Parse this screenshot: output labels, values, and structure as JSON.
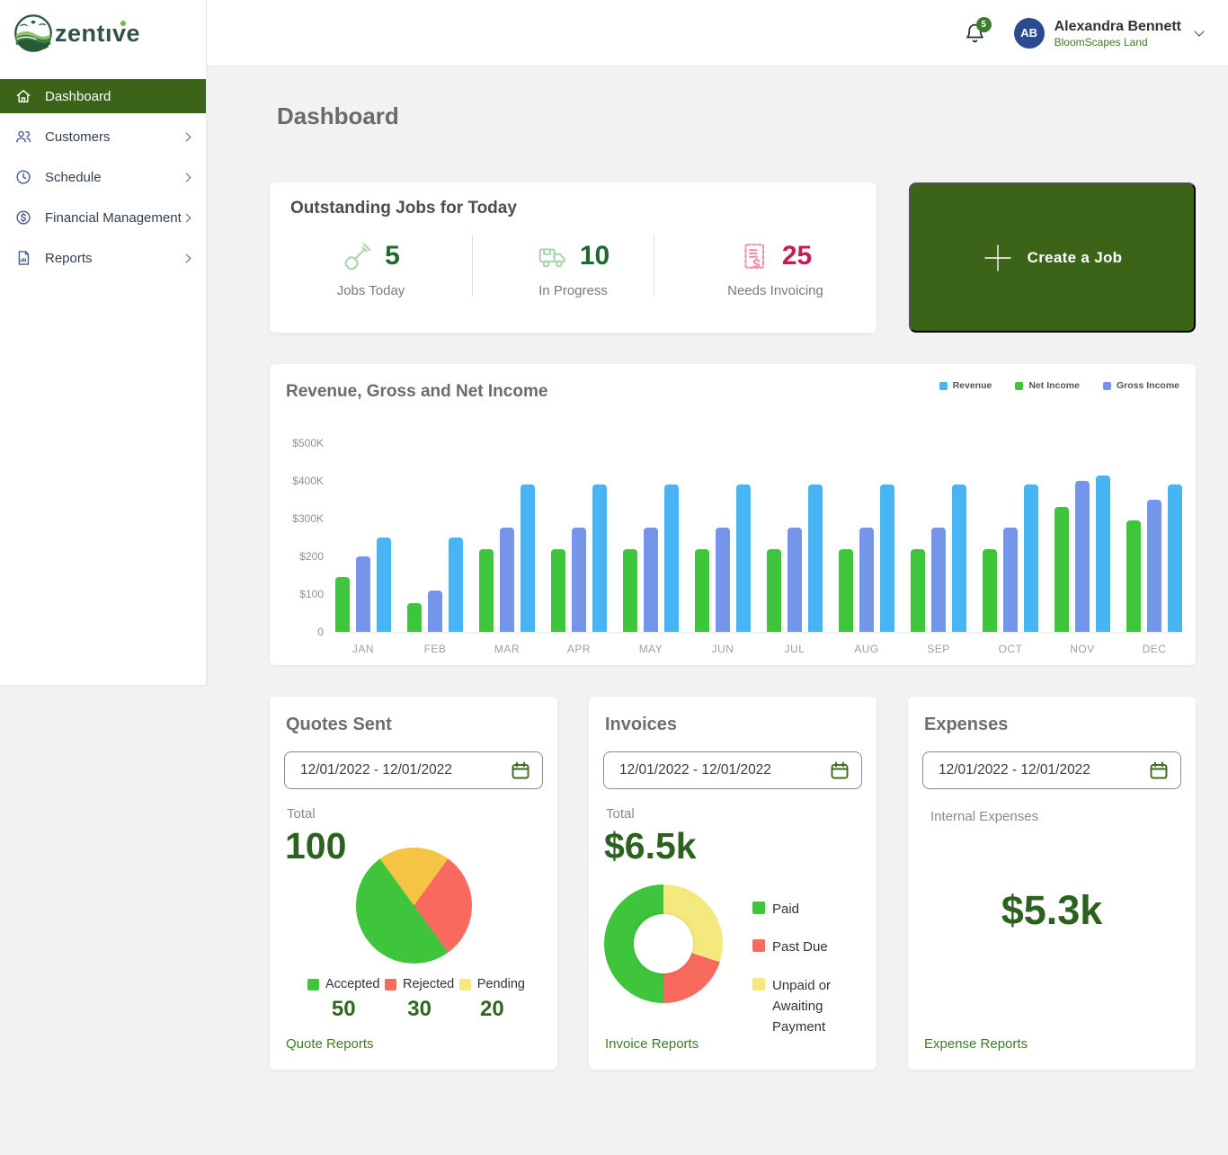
{
  "brand": {
    "name": "zentive"
  },
  "sidebar": {
    "items": [
      {
        "label": "Dashboard",
        "icon": "home-icon",
        "active": true
      },
      {
        "label": "Customers",
        "icon": "users-icon",
        "active": false
      },
      {
        "label": "Schedule",
        "icon": "clock-icon",
        "active": false
      },
      {
        "label": "Financial Management",
        "icon": "dollar-circle-icon",
        "active": false
      },
      {
        "label": "Reports",
        "icon": "report-icon",
        "active": false
      }
    ]
  },
  "header": {
    "notification_count": "5",
    "avatar_initials": "AB",
    "user_name": "Alexandra Bennett",
    "company": "BloomScapes Land"
  },
  "page": {
    "title": "Dashboard"
  },
  "outstanding": {
    "title": "Outstanding Jobs for Today",
    "stats": [
      {
        "value": "5",
        "label": "Jobs Today",
        "icon": "shovel-icon",
        "value_color": "#1d6a30"
      },
      {
        "value": "10",
        "label": "In Progress",
        "icon": "truck-icon",
        "value_color": "#1d6a30"
      },
      {
        "value": "25",
        "label": "Needs Invoicing",
        "icon": "invoice-icon",
        "value_color": "#c11d56"
      }
    ]
  },
  "create_job": {
    "label": "Create a Job"
  },
  "chart_data": [
    {
      "type": "bar",
      "title": "Revenue, Gross and Net Income",
      "categories": [
        "JAN",
        "FEB",
        "MAR",
        "APR",
        "MAY",
        "JUN",
        "JUL",
        "AUG",
        "SEP",
        "OCT",
        "NOV",
        "DEC"
      ],
      "series": [
        {
          "name": "Net Income",
          "color": "#3ec53c",
          "values": [
            145,
            75,
            220,
            220,
            220,
            220,
            220,
            220,
            220,
            220,
            330,
            295
          ]
        },
        {
          "name": "Gross Income",
          "color": "#7595ea",
          "values": [
            200,
            110,
            275,
            275,
            275,
            275,
            275,
            275,
            275,
            275,
            400,
            350
          ]
        },
        {
          "name": "Revenue",
          "color": "#47b5f4",
          "values": [
            250,
            250,
            390,
            390,
            390,
            390,
            390,
            390,
            390,
            390,
            415,
            390
          ]
        }
      ],
      "legend": [
        {
          "label": "Revenue",
          "color": "#47b5f4"
        },
        {
          "label": "Net Income",
          "color": "#3ec53c"
        },
        {
          "label": "Gross Income",
          "color": "#7595ea"
        }
      ],
      "legend_position": "top-right",
      "grid": false,
      "units": "$K",
      "ylim": [
        0,
        500
      ],
      "y_ticks": [
        {
          "label": "$500K",
          "value": 500
        },
        {
          "label": "$400K",
          "value": 400
        },
        {
          "label": "$300K",
          "value": 300
        },
        {
          "label": "$200",
          "value": 200
        },
        {
          "label": "$100",
          "value": 100
        },
        {
          "label": "0",
          "value": 0
        }
      ]
    },
    {
      "type": "pie",
      "title": "Quotes Sent",
      "total": 100,
      "start_angle": -36,
      "segments": [
        {
          "label": "Pending",
          "value": 20,
          "color": "#f6c444"
        },
        {
          "label": "Rejected",
          "value": 30,
          "color": "#f8695e"
        },
        {
          "label": "Accepted",
          "value": 50,
          "color": "#3ec53c"
        }
      ]
    },
    {
      "type": "donut",
      "title": "Invoices",
      "total_label": "$6.5k",
      "start_angle": 0,
      "segments": [
        {
          "label": "Unpaid or Awaiting Payment",
          "value": 30,
          "color": "#f3e97d"
        },
        {
          "label": "Past Due",
          "value": 20,
          "color": "#f8695e"
        },
        {
          "label": "Paid",
          "value": 50,
          "color": "#3ec53c"
        }
      ]
    }
  ],
  "quotes": {
    "title": "Quotes Sent",
    "date_range": "12/01/2022  - 12/01/2022",
    "total_label": "Total",
    "total_value": "100",
    "legend": [
      {
        "label": "Accepted",
        "value": "50",
        "color": "#3ec53c"
      },
      {
        "label": "Rejected",
        "value": "30",
        "color": "#f8695e"
      },
      {
        "label": "Pending",
        "value": "20",
        "color": "#f2ea7a"
      }
    ],
    "link": "Quote Reports"
  },
  "invoices": {
    "title": "Invoices",
    "date_range": "12/01/2022  - 12/01/2022",
    "total_label": "Total",
    "total_value": "$6.5k",
    "legend": [
      {
        "label": "Paid",
        "color": "#3ec53c"
      },
      {
        "label": "Past Due",
        "color": "#f8695e"
      },
      {
        "label": "Unpaid or",
        "label2": "Awaiting Payment",
        "color": "#f3e97d"
      }
    ],
    "link": "Invoice Reports"
  },
  "expenses": {
    "title": "Expenses",
    "date_range": "12/01/2022  - 12/01/2022",
    "subtitle": "Internal Expenses",
    "amount": "$5.3k",
    "link": "Expense Reports"
  }
}
